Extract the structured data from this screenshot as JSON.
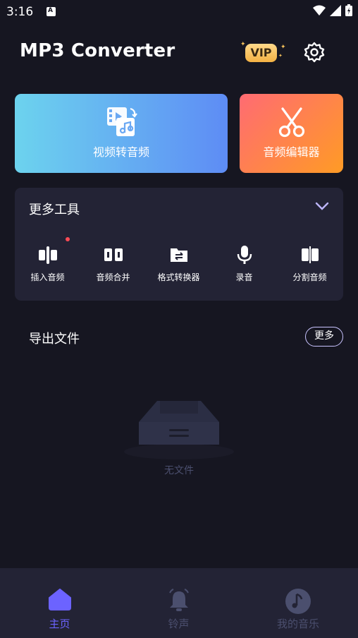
{
  "status_bar": {
    "time": "3:16",
    "notif_letter": "A"
  },
  "header": {
    "title": "MP3 Converter",
    "vip_label": "VIP"
  },
  "cards": {
    "video_to_audio": "视频转音频",
    "audio_editor": "音频编辑器"
  },
  "tools": {
    "title": "更多工具",
    "items": [
      {
        "label": "插入音频",
        "icon": "insert-audio-icon"
      },
      {
        "label": "音频合并",
        "icon": "merge-audio-icon"
      },
      {
        "label": "格式转换器",
        "icon": "format-convert-icon"
      },
      {
        "label": "录音",
        "icon": "microphone-icon"
      },
      {
        "label": "分割音频",
        "icon": "split-audio-icon"
      }
    ]
  },
  "export": {
    "title": "导出文件",
    "more_label": "更多",
    "empty_text": "无文件"
  },
  "nav": [
    {
      "label": "主页",
      "icon": "home-icon"
    },
    {
      "label": "铃声",
      "icon": "bell-icon"
    },
    {
      "label": "我的音乐",
      "icon": "music-note-icon"
    }
  ],
  "colors": {
    "background": "#161621",
    "panel": "#232335",
    "accent": "#6c63ff",
    "nav_active": "#6c63ff",
    "nav_inactive": "#4b4f6e"
  }
}
